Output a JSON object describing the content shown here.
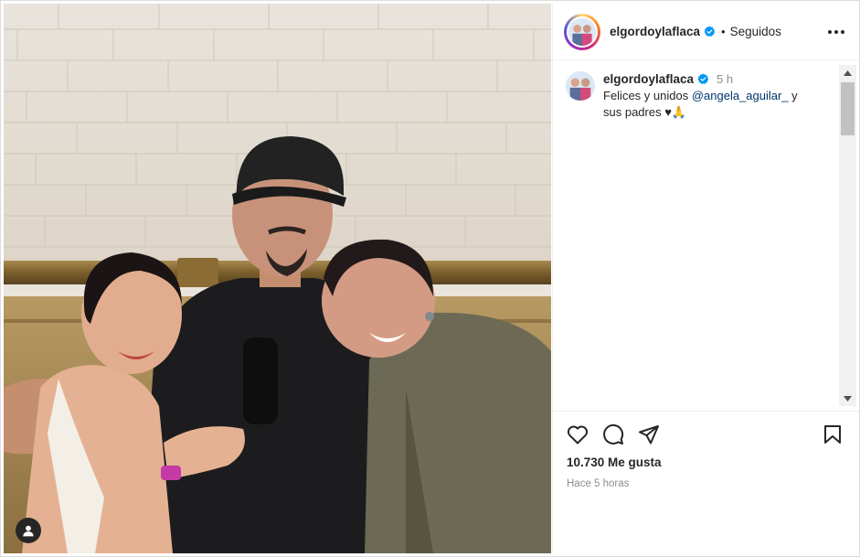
{
  "post": {
    "username": "elgordoylaflaca",
    "verified": true,
    "follow_status": "Seguidos",
    "separator": "•"
  },
  "caption": {
    "username": "elgordoylaflaca",
    "time": "5 h",
    "text_before": "Felices y unidos ",
    "mention": "@angela_aguilar_",
    "text_after": " y sus padres ♥🙏"
  },
  "stats": {
    "likes": "10.730 Me gusta",
    "timestamp": "Hace 5 horas"
  },
  "icons": {
    "more": "more-options-icon",
    "like": "heart-icon",
    "comment": "comment-icon",
    "share": "share-icon",
    "save": "bookmark-icon",
    "tags": "user-tag-icon",
    "verified": "verified-badge-icon"
  },
  "colors": {
    "verified": "#0095f6",
    "mention": "#00376b",
    "muted": "#8e8e8e"
  }
}
